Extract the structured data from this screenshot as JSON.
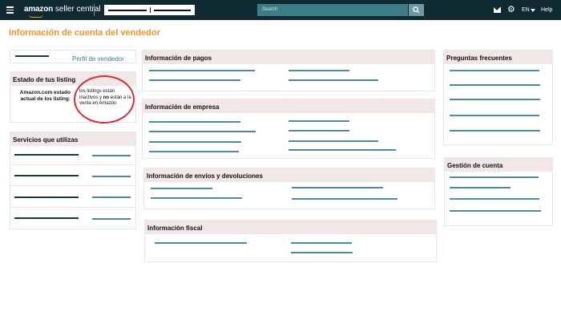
{
  "header": {
    "logo_brand": "amazon",
    "logo_product": "seller central",
    "search_placeholder": "Search",
    "language": "EN",
    "help": "Help"
  },
  "page_title": "Información de cuenta del vendedor",
  "profile": {
    "link": "Perfil de vendedor"
  },
  "listing_status": {
    "title": "Estado de tus listing",
    "label": "Amazon.com estado actual de los listing:",
    "note_before": "los listings están inactivos y ",
    "note_bold": "no",
    "note_after": " están a la venta en Amazon"
  },
  "services": {
    "title": "Servicios que utilizas"
  },
  "payments": {
    "title": "Información de pagos"
  },
  "business": {
    "title": "Información de empresa"
  },
  "shipping": {
    "title": "Información de envíos y devoluciones"
  },
  "tax": {
    "title": "Información fiscal"
  },
  "faq": {
    "title": "Preguntas frecuentes"
  },
  "account_mgmt": {
    "title": "Gestión de cuenta"
  },
  "colors": {
    "accent": "#e8952f",
    "header_bg": "#0f2a30",
    "link": "#3d7b88",
    "card_head": "#f1e7e6",
    "highlight": "#d4303a"
  }
}
